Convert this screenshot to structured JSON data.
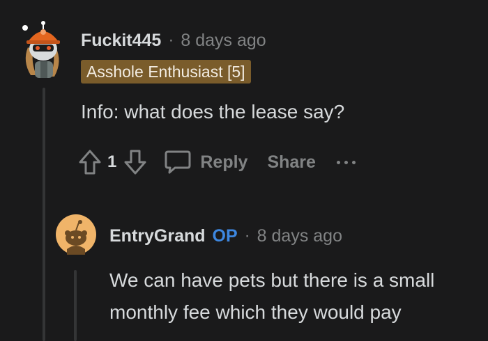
{
  "comment1": {
    "username": "Fuckit445",
    "separator": "·",
    "timestamp": "8 days ago",
    "flair": "Asshole Enthusiast [5]",
    "body": "Info: what does the lease say?",
    "avatar_icon": "snoo-avatar-icon",
    "actions": {
      "upvote_icon": "upvote-arrow-icon",
      "vote_count": "1",
      "downvote_icon": "downvote-arrow-icon",
      "reply_icon": "speech-bubble-icon",
      "reply_label": "Reply",
      "share_label": "Share",
      "more_icon": "ellipsis-icon"
    }
  },
  "comment2": {
    "username": "EntryGrand",
    "op_badge": "OP",
    "separator": "·",
    "timestamp": "8 days ago",
    "avatar_icon": "snoo-avatar-icon",
    "body": "We can have pets but there is a small monthly fee which they would pay"
  },
  "colors": {
    "background": "#1a1a1b",
    "text": "#d7dadc",
    "muted": "#818384",
    "flair_bg": "#7a5c2b",
    "op_blue": "#3d87e0"
  }
}
